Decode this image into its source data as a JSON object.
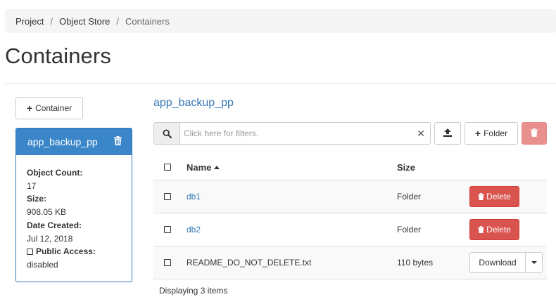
{
  "breadcrumb": {
    "items": [
      {
        "label": "Project"
      },
      {
        "label": "Object Store"
      },
      {
        "label": "Containers"
      }
    ],
    "separator": "/"
  },
  "page": {
    "title": "Containers"
  },
  "sidebar": {
    "add_container_label": "Container",
    "container": {
      "name": "app_backup_pp",
      "object_count_label": "Object Count:",
      "object_count": "17",
      "size_label": "Size:",
      "size": "908.05 KB",
      "date_created_label": "Date Created:",
      "date_created": "Jul 12, 2018",
      "public_access_label": "Public Access:",
      "public_access": "disabled"
    }
  },
  "main": {
    "container_name": "app_backup_pp",
    "filter_placeholder": "Click here for filters.",
    "folder_button_label": "Folder",
    "table": {
      "columns": [
        "Name",
        "Size"
      ],
      "rows": [
        {
          "name": "db1",
          "size": "Folder",
          "action": "Delete"
        },
        {
          "name": "db2",
          "size": "Folder",
          "action": "Delete"
        },
        {
          "name": "README_DO_NOT_DELETE.txt",
          "size": "110 bytes",
          "action": "Download"
        }
      ]
    },
    "footer": "Displaying 3 items"
  },
  "colors": {
    "primary": "#3b86c8",
    "link": "#3478b6",
    "danger": "#d9534f",
    "danger_disabled": "#e8908d"
  },
  "icons": [
    "search-icon",
    "clear-icon",
    "upload-icon",
    "plus-icon",
    "trash-icon",
    "sort-asc-icon",
    "caret-down-icon",
    "checkbox-icon"
  ]
}
